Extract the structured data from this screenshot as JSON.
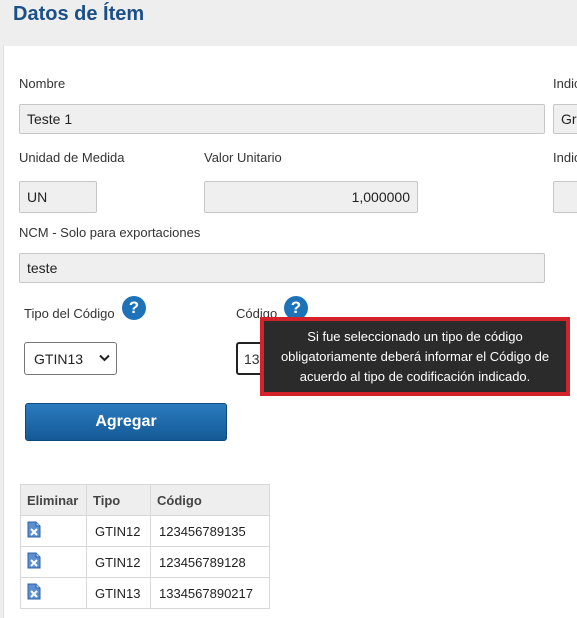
{
  "header": {
    "title": "Datos de Ítem"
  },
  "form": {
    "nombre": {
      "label": "Nombre",
      "value": "Teste 1"
    },
    "indicador_right_1": {
      "label": "Indic",
      "value": "Gr"
    },
    "unidad": {
      "label": "Unidad de Medida",
      "value": "UN"
    },
    "valor_unitario": {
      "label": "Valor Unitario",
      "value": "1,000000"
    },
    "indicador_right_2": {
      "label": "Indic",
      "value": ""
    },
    "ncm": {
      "label": "NCM - Solo para exportaciones",
      "value": "teste"
    },
    "tipo_codigo": {
      "label": "Tipo del Código",
      "value": "GTIN13",
      "help_glyph": "?"
    },
    "codigo": {
      "label": "Código",
      "value": "13",
      "help_glyph": "?"
    },
    "add_button": {
      "label": "Agregar"
    }
  },
  "tooltip": {
    "lines": [
      "Si fue seleccionado un tipo de código",
      "obligatoriamente deberá informar el Código de",
      "acuerdo al tipo de codificación indicado."
    ]
  },
  "table": {
    "headers": [
      "Eliminar",
      "Tipo",
      "Código"
    ],
    "rows": [
      {
        "tipo": "GTIN12",
        "codigo": "123456789135"
      },
      {
        "tipo": "GTIN12",
        "codigo": "123456789128"
      },
      {
        "tipo": "GTIN13",
        "codigo": "1334567890217"
      }
    ]
  },
  "icons": {
    "help": "question-circle-icon",
    "delete": "file-delete-icon",
    "chevron": "chevron-down-icon"
  },
  "colors": {
    "title": "#1b4f86",
    "button": "#1d6aa8",
    "tooltip_border": "#d3222a",
    "help": "#1d72b8"
  }
}
